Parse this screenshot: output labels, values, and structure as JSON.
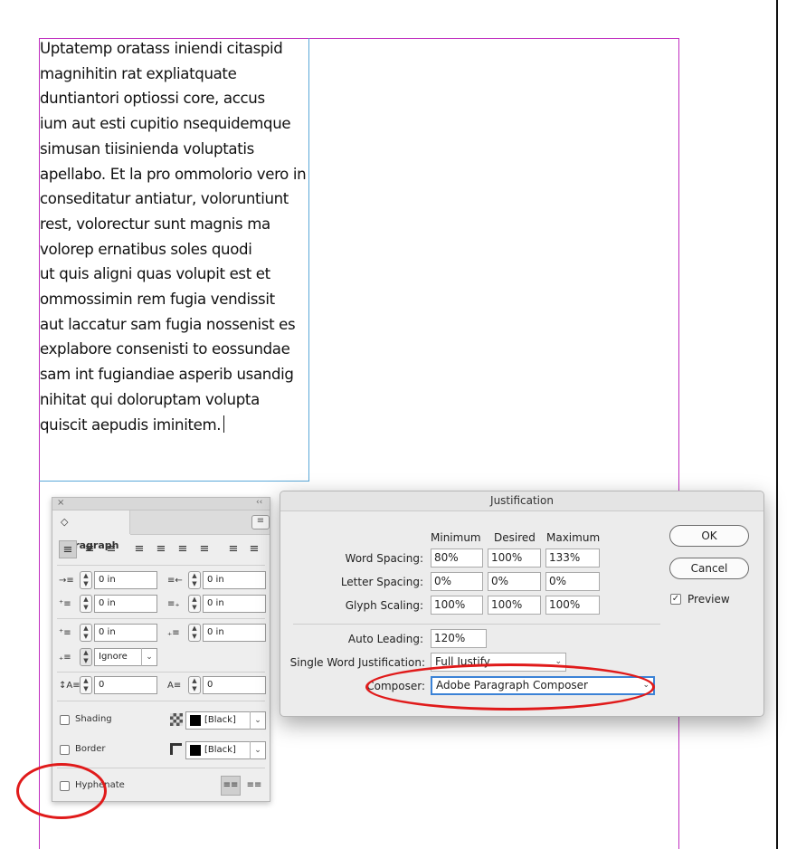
{
  "story": {
    "lines": [
      "Uptatemp oratass iniendi citaspid",
      "magnihitin rat expliatquate",
      "duntiantori optiossi core, accus",
      "ium aut esti cupitio nsequidemque",
      "simusan tiisinienda voluptatis",
      "apellabo. Et la pro ommolorio vero in",
      "conseditatur antiatur, voloruntiunt",
      "rest, volorectur sunt magnis ma",
      "volorep ernatibus soles quodi",
      "ut quis aligni quas volupit est et",
      "ommossimin rem fugia vendissit",
      "aut laccatur sam fugia nossenist es",
      "explabore consenisti to eossundae",
      "sam int fugiandiae asperib usandig",
      "nihitat qui doloruptam volupta",
      "quiscit aepudis iminitem."
    ]
  },
  "paragraph_panel": {
    "close_glyph": "×",
    "collapse_glyph": "‹‹",
    "tab_label": "◇ Paragraph",
    "menu_glyph": "≡",
    "left_indent": "0 in",
    "right_indent": "0 in",
    "first_line_indent": "0 in",
    "last_line_indent": "0 in",
    "space_before": "0 in",
    "space_after": "0 in",
    "align_to_grid": "Ignore",
    "drop_cap_lines": "0",
    "drop_cap_chars": "0",
    "shading_label": "Shading",
    "shading_swatch": "[Black]",
    "border_label": "Border",
    "border_swatch": "[Black]",
    "hyphenate_label": "Hyphenate"
  },
  "justification_dialog": {
    "title": "Justification",
    "columns": [
      "Minimum",
      "Desired",
      "Maximum"
    ],
    "rows": [
      {
        "label": "Word Spacing:",
        "min": "80%",
        "desired": "100%",
        "max": "133%"
      },
      {
        "label": "Letter Spacing:",
        "min": "0%",
        "desired": "0%",
        "max": "0%"
      },
      {
        "label": "Glyph Scaling:",
        "min": "100%",
        "desired": "100%",
        "max": "100%"
      }
    ],
    "auto_leading_label": "Auto Leading:",
    "auto_leading_value": "120%",
    "single_word_label": "Single Word Justification:",
    "single_word_value": "Full Justify",
    "composer_label": "Composer:",
    "composer_value": "Adobe Paragraph Composer",
    "ok_label": "OK",
    "cancel_label": "Cancel",
    "preview_label": "Preview",
    "preview_checked": true
  },
  "colors": {
    "margin_guide": "#c02ec0",
    "frame_edge": "#5aa8d8",
    "annotation": "#e01a1a",
    "focus_ring": "#3b82d6"
  }
}
